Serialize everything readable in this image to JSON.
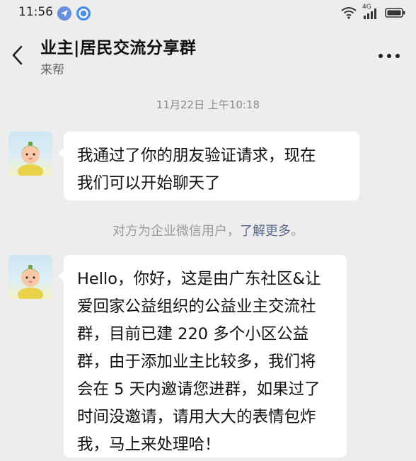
{
  "status_bar": {
    "time": "11:56",
    "network_label": "4G"
  },
  "header": {
    "title": "业主|居民交流分享群",
    "subtitle": "来帮"
  },
  "chat": {
    "timestamp": "11月22日 上午10:18",
    "messages": [
      {
        "text_lines": [
          "我通过了你的朋友验证请求，现在",
          "我们可以开始聊天了"
        ]
      },
      {
        "text_lines": [
          "Hello，你好，这是由广东社区&让",
          "爱回家公益组织的公益业主交流社",
          "群，目前已建 220 多个小区公益",
          "群，由于添加业主比较多，我们将",
          "会在 5 天内邀请您进群，如果过了",
          "时间没邀请，请用大大的表情包炸",
          "我，马上来处理哈！"
        ]
      }
    ],
    "system_notice": {
      "prefix": "对方为企业微信用户，",
      "link": "了解更多",
      "suffix": "。"
    }
  },
  "colors": {
    "background": "#ededed",
    "bubble": "#ffffff",
    "link": "#5b6b8c"
  }
}
